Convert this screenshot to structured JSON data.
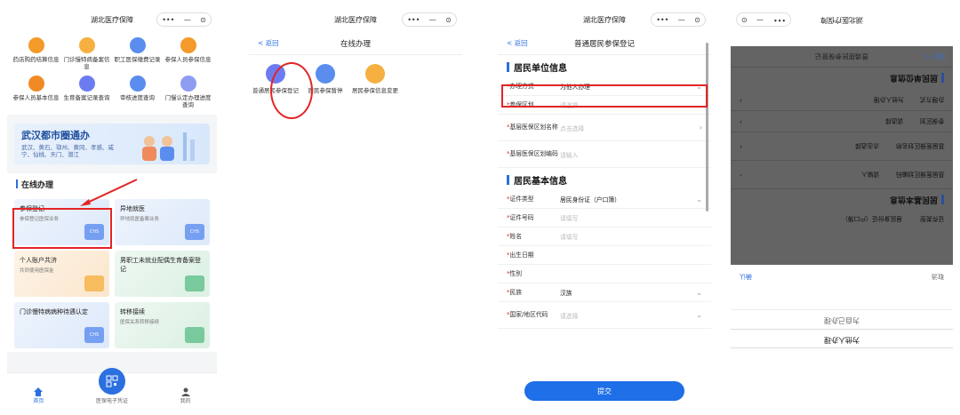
{
  "p1": {
    "title": "湖北医疗保障",
    "capsule": {
      "more": "•••",
      "min": "—",
      "close": "⊙"
    },
    "grid": [
      {
        "label": "药店购药结算信息",
        "color": "#f39a2b"
      },
      {
        "label": "门诊慢特病备案信息",
        "color": "#f5b041"
      },
      {
        "label": "职工医保缴费记录",
        "color": "#5b8def"
      },
      {
        "label": "参保人员参保信息",
        "color": "#f39a2b"
      },
      {
        "label": "参保人员基本信息",
        "color": "#f08a24"
      },
      {
        "label": "生育备案记录查询",
        "color": "#6c7cf0"
      },
      {
        "label": "审核进度查询",
        "color": "#5b8def"
      },
      {
        "label": "门慢认定办理进度查询",
        "color": "#8e9cf2"
      }
    ],
    "banner": {
      "title": "武汉都市圈通办",
      "subtitle": "武汉、黄石、鄂州、黄冈、孝感、咸宁、仙桃、天门、潜江"
    },
    "section": "在线办理",
    "cards": [
      {
        "title": "参保登记",
        "sub": "参保登记医保业务",
        "style": "blue"
      },
      {
        "title": "异地就医",
        "sub": "异地就医备案业务",
        "style": "blue"
      },
      {
        "title": "个人账户共济",
        "sub": "共同使用医保金",
        "style": "orange"
      },
      {
        "title": "男职工未就业配偶生育备案登记",
        "sub": "",
        "style": "green"
      },
      {
        "title": "门诊慢特病病种待遇认定",
        "sub": "",
        "style": "blue"
      },
      {
        "title": "转移接续",
        "sub": "医保关系转移接续",
        "style": "green"
      }
    ],
    "card_badge": "CHS",
    "tabs": [
      {
        "label": "首页",
        "icon": "home-icon"
      },
      {
        "label": "医保电子凭证",
        "icon": "qrcode-icon"
      },
      {
        "label": "我的",
        "icon": "person-icon"
      }
    ]
  },
  "p2": {
    "title": "湖北医疗保障",
    "capsule": {
      "more": "•••",
      "min": "—",
      "close": "⊙"
    },
    "back": "< 返回",
    "nav_title": "在线办理",
    "items": [
      {
        "label": "普通居民参保登记",
        "color": "#6c7cf0"
      },
      {
        "label": "居民参保暂停",
        "color": "#5b8def"
      },
      {
        "label": "居民参保信息变更",
        "color": "#f5b041"
      }
    ]
  },
  "p3": {
    "title": "湖北医疗保障",
    "capsule": {
      "more": "•••",
      "min": "—",
      "close": "⊙"
    },
    "back": "< 返回",
    "nav_title": "普通居民参保登记",
    "sec1": "居民单位信息",
    "rows1": [
      {
        "label": "办理方式",
        "value": "为他人办理",
        "ph": false,
        "chev": "⌄"
      },
      {
        "label": "参保区划",
        "value": "请选择",
        "ph": true,
        "chev": ""
      },
      {
        "label": "基层医保区划名称",
        "value": "点击选择",
        "ph": true,
        "chev": "›"
      },
      {
        "label": "基层医保区划编码",
        "value": "请输入",
        "ph": true,
        "chev": ""
      }
    ],
    "sec2": "居民基本信息",
    "rows2": [
      {
        "label": "证件类型",
        "value": "居民身份证（户口簿）",
        "ph": false,
        "chev": "⌄"
      },
      {
        "label": "证件号码",
        "value": "请填写",
        "ph": true,
        "chev": ""
      },
      {
        "label": "姓名",
        "value": "请填写",
        "ph": true,
        "chev": ""
      },
      {
        "label": "出生日期",
        "value": "",
        "ph": true,
        "chev": ""
      },
      {
        "label": "性别",
        "value": "",
        "ph": true,
        "chev": ""
      },
      {
        "label": "民族",
        "value": "汉族",
        "ph": false,
        "chev": "⌄"
      },
      {
        "label": "国家/地区代码",
        "value": "请选择",
        "ph": true,
        "chev": "⌄"
      }
    ],
    "submit": "提交"
  },
  "p4": {
    "title": "湖北医疗保障",
    "capsule": {
      "more": "•••",
      "min": "—",
      "close": "⊙"
    },
    "back": "返回 <",
    "nav_title": "普通居民参保登记",
    "sec1": "居民单位信息",
    "labels": [
      "办理方式",
      "参保区划",
      "基层医保区划名称",
      "基层医保区划编码"
    ],
    "values": [
      "为他人办理",
      "请选择",
      "点击选择",
      "请输入"
    ],
    "sec2": "居民基本信息",
    "row2": {
      "label": "证件类型",
      "value": "居民身份证（户口簿）"
    },
    "picker": {
      "cancel": "取消",
      "confirm": "确认",
      "options": [
        "为自己办理",
        "为他人办理"
      ]
    }
  }
}
